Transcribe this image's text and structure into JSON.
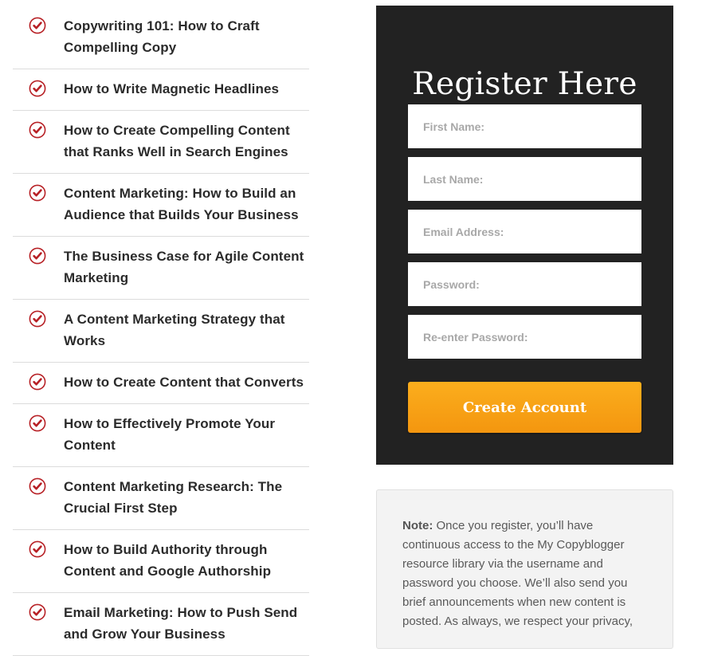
{
  "courses": [
    {
      "title": "Copywriting 101: How to Craft Compelling Copy"
    },
    {
      "title": "How to Write Magnetic Headlines"
    },
    {
      "title": "How to Create Compelling Content that Ranks Well in Search Engines"
    },
    {
      "title": "Content Marketing: How to Build an Audience that Builds Your Business"
    },
    {
      "title": "The Business Case for Agile Content Marketing"
    },
    {
      "title": "A Content Marketing Strategy that Works"
    },
    {
      "title": "How to Create Content that Converts"
    },
    {
      "title": "How to Effectively Promote Your Content"
    },
    {
      "title": "Content Marketing Research: The Crucial First Step"
    },
    {
      "title": "How to Build Authority through Content and Google Authorship"
    },
    {
      "title": "Email Marketing: How to Push Send and Grow Your Business"
    }
  ],
  "icons": {
    "course_check": "check-circle-icon"
  },
  "colors": {
    "accent_red": "#b72025",
    "panel_bg": "#222222",
    "button_orange": "#f8a216"
  },
  "register": {
    "title": "Register Here",
    "fields": {
      "first_name": {
        "placeholder": "First Name:",
        "value": ""
      },
      "last_name": {
        "placeholder": "Last Name:",
        "value": ""
      },
      "email": {
        "placeholder": "Email Address:",
        "value": ""
      },
      "password": {
        "placeholder": "Password:",
        "value": ""
      },
      "password_confirm": {
        "placeholder": "Re-enter Password:",
        "value": ""
      }
    },
    "submit_label": "Create Account"
  },
  "note": {
    "label": "Note:",
    "text": " Once you register, you’ll have continuous access to the My Copyblogger resource library via the username and password you choose. We’ll also send you brief announcements when new content is posted. As always, we respect your privacy,"
  }
}
